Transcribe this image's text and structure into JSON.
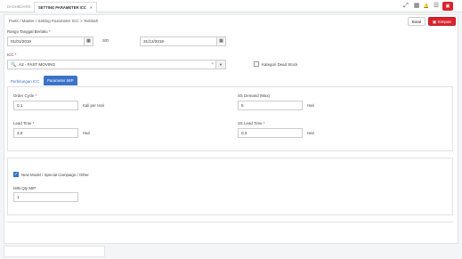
{
  "tabs": [
    {
      "label": "DASHBOARD"
    },
    {
      "label": "SETTING PARAMETER ICC",
      "close": "×"
    }
  ],
  "toolbar_icons": {
    "fullscreen": "⤢",
    "grid": "▦",
    "bell": "🔔",
    "menu": "☰",
    "user": "▣"
  },
  "breadcrumb": "Parts  /  Master  /  Setting Parameter ICC  >  Tambah",
  "buttons": {
    "back": "Batal",
    "save": "Simpan"
  },
  "date_range": {
    "label": "Rango Tanggal Berlaku",
    "required": "*",
    "from": "01/01/2019",
    "separator": "S/D",
    "to": "31/12/2019",
    "calendar_icon": "▦"
  },
  "icc": {
    "label": "ICC",
    "required": "*",
    "value": "A2 - FAST MOVING",
    "clear": "×",
    "arrow": "▼",
    "search_icon": "🔍"
  },
  "dead_stock": {
    "label": "Kategori Dead Stock",
    "checked": false
  },
  "param_tabs": [
    {
      "label": "Perhitungan ICC"
    },
    {
      "label": "Parameter MIP"
    }
  ],
  "order_cycle": {
    "label": "Order Cycle",
    "required": "*",
    "value": "0.1",
    "unit": "Kali per Hari"
  },
  "ss_demand": {
    "label": "SS Demand (Max)",
    "value": "5",
    "unit": "Hari"
  },
  "lead_time": {
    "label": "Lead Time",
    "required": "*",
    "value": "3.0",
    "unit": "Hari"
  },
  "ss_lead_time": {
    "label": "SS Lead Time",
    "required": "*",
    "value": "0.3",
    "unit": "Hari"
  },
  "new_model": {
    "label": "New Model / Special Campaign / Other",
    "checked": true,
    "check": "✓"
  },
  "min_qty": {
    "label": "MIN Qty MIP",
    "value": "1"
  }
}
